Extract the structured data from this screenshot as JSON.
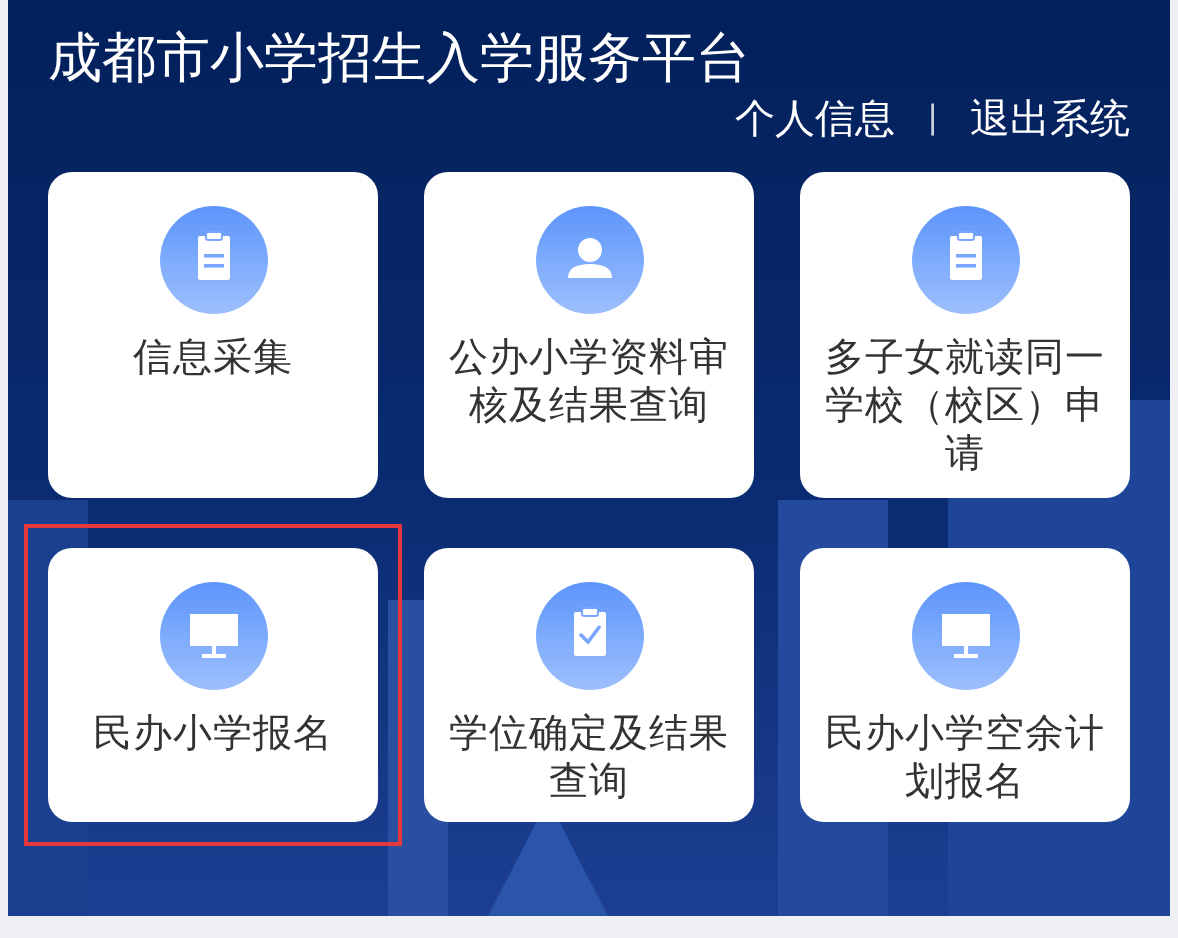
{
  "header": {
    "title": "成都市小学招生入学服务平台",
    "links": [
      {
        "label": "个人信息"
      },
      {
        "label": "退出系统"
      }
    ],
    "separator": "|"
  },
  "tiles": [
    {
      "label": "信息采集",
      "highlighted": false
    },
    {
      "label": "公办小学资料审核及结果查询",
      "highlighted": false
    },
    {
      "label": "多子女就读同一学校（校区）申请",
      "highlighted": false
    },
    {
      "label": "民办小学报名",
      "highlighted": true
    },
    {
      "label": "学位确定及结果查询",
      "highlighted": false
    },
    {
      "label": "民办小学空余计划报名",
      "highlighted": false
    }
  ]
}
